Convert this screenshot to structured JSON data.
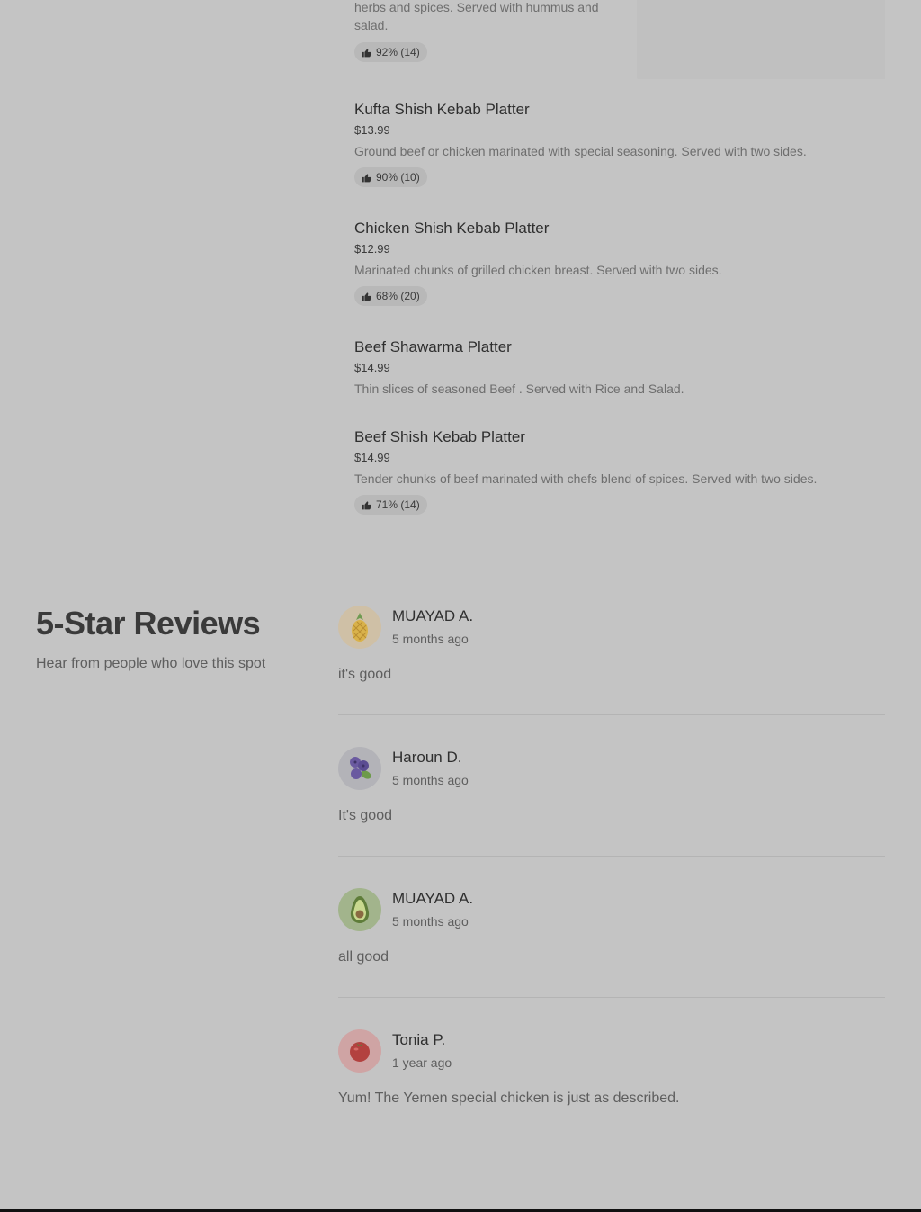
{
  "menu": {
    "first_item": {
      "description": "herbs and spices. Served with hummus and salad.",
      "rating": "92% (14)"
    },
    "items": [
      {
        "title": "Kufta Shish Kebab Platter",
        "price": "$13.99",
        "description": "Ground beef or chicken marinated with special seasoning. Served with two sides.",
        "rating": "90% (10)"
      },
      {
        "title": "Chicken Shish Kebab Platter",
        "price": "$12.99",
        "description": "Marinated chunks of grilled chicken breast. Served with two sides.",
        "rating": "68% (20)"
      },
      {
        "title": "Beef Shawarma Platter",
        "price": "$14.99",
        "description": "Thin slices of seasoned Beef . Served with Rice and Salad."
      },
      {
        "title": "Beef Shish Kebab Platter",
        "price": "$14.99",
        "description": "Tender chunks of beef marinated with chefs blend of spices. Served with two sides.",
        "rating": "71% (14)"
      }
    ]
  },
  "reviews_section": {
    "heading": "5-Star Reviews",
    "subheading": "Hear from people who love this spot",
    "reviews": [
      {
        "name": "MUAYAD A.",
        "time": "5 months ago",
        "text": "it's good",
        "avatar_icon": "pineapple-icon",
        "avatar_bg": "#cfc0a6"
      },
      {
        "name": "Haroun D.",
        "time": "5 months ago",
        "text": "It's good",
        "avatar_icon": "blueberry-icon",
        "avatar_bg": "#b3b3b8"
      },
      {
        "name": "MUAYAD A.",
        "time": "5 months ago",
        "text": "all good",
        "avatar_icon": "avocado-icon",
        "avatar_bg": "#a2b48c"
      },
      {
        "name": "Tonia P.",
        "time": "1 year ago",
        "text": "Yum! The Yemen special chicken is just as described.",
        "avatar_icon": "tomato-icon",
        "avatar_bg": "#cfa4a4"
      }
    ]
  },
  "icons": {
    "rating": "thumbs-up-icon"
  }
}
